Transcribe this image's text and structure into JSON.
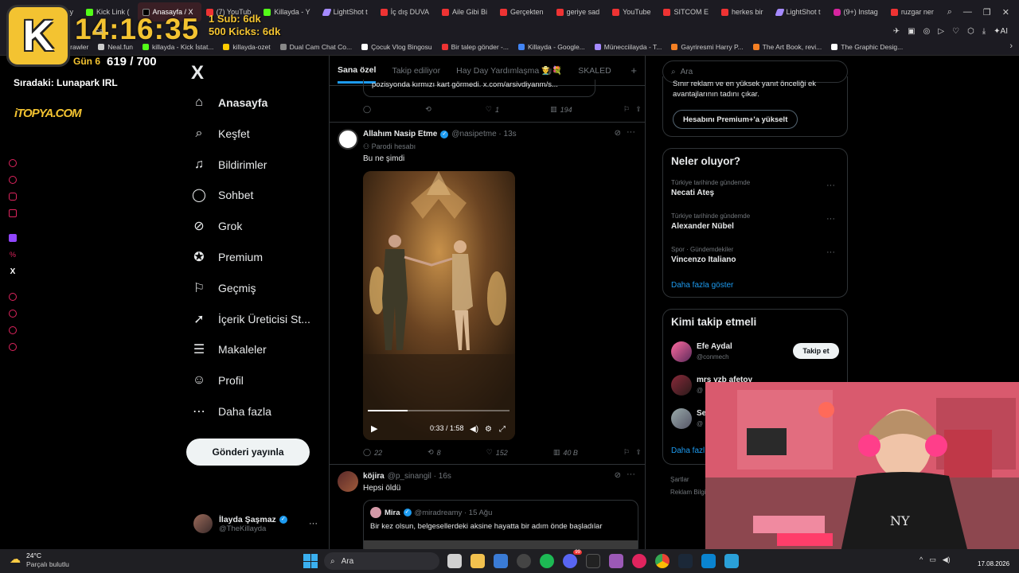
{
  "browser": {
    "tabs": [
      {
        "label": "away",
        "fav": "yt"
      },
      {
        "label": "Kick Link (",
        "fav": "k"
      },
      {
        "label": "Anasayfa / X",
        "fav": "x",
        "active": true
      },
      {
        "label": "(7) YouTub",
        "fav": "yt"
      },
      {
        "label": "Killayda - Y",
        "fav": "k"
      },
      {
        "label": "LightShot t",
        "fav": "ls"
      },
      {
        "label": "İç dış DUVA",
        "fav": "yt"
      },
      {
        "label": "Aile Gibi Bi",
        "fav": "yt"
      },
      {
        "label": "Gerçekten",
        "fav": "yt"
      },
      {
        "label": "geriye sad",
        "fav": "yt"
      },
      {
        "label": "YouTube",
        "fav": "yt"
      },
      {
        "label": "SITCOM E",
        "fav": "yt"
      },
      {
        "label": "herkes bir",
        "fav": "yt"
      },
      {
        "label": "LightShot t",
        "fav": "ls"
      },
      {
        "label": "(9+) Instag",
        "fav": "ig"
      },
      {
        "label": "ruzgar ner",
        "fav": "yt"
      }
    ],
    "new_tab": "+",
    "url_fragment": "ca",
    "bookmarks": [
      "Crawler",
      "Neal.fun",
      "killayda - Kick İstat...",
      "killayda-ozet",
      "Dual Cam Chat Co...",
      "Çocuk Vlog Bingosu",
      "Bir talep gönder -...",
      "Killayda - Google...",
      "Münecciilayda - T...",
      "Gayriresmi Harry P...",
      "The Art Book, revi...",
      "The Graphic Desig..."
    ]
  },
  "overlay": {
    "logo_letter": "K",
    "clock": "14:16:35",
    "sub_line": "1 Sub: 6dk",
    "kick_line": "500 Kicks: 6dk",
    "day_label": "Gün 6",
    "progress": "619 / 700",
    "next_label": "Sıradaki: Lunapark IRL",
    "sponsor": "iTOPYA.COM"
  },
  "x": {
    "logo": "X",
    "nav": [
      {
        "label": "Anasayfa",
        "icon": "home-icon",
        "glyph": "⌂"
      },
      {
        "label": "Keşfet",
        "icon": "search-icon",
        "glyph": "⌕"
      },
      {
        "label": "Bildirimler",
        "icon": "bell-icon",
        "glyph": "♫"
      },
      {
        "label": "Sohbet",
        "icon": "chat-icon",
        "glyph": "◯"
      },
      {
        "label": "Grok",
        "icon": "grok-icon",
        "glyph": "⊘"
      },
      {
        "label": "Premium",
        "icon": "premium-icon",
        "glyph": "✪"
      },
      {
        "label": "Geçmiş",
        "icon": "bookmark-icon",
        "glyph": "⚐"
      },
      {
        "label": "İçerik Üreticisi St...",
        "icon": "rocket-icon",
        "glyph": "➚"
      },
      {
        "label": "Makaleler",
        "icon": "article-icon",
        "glyph": "☰"
      },
      {
        "label": "Profil",
        "icon": "profile-icon",
        "glyph": "☺"
      },
      {
        "label": "Daha fazla",
        "icon": "more-icon",
        "glyph": "⋯"
      }
    ],
    "post_button": "Gönderi yayınla",
    "profile": {
      "name": "İlayda Şaşmaz",
      "handle": "@TheKillayda",
      "more": "···"
    }
  },
  "feed": {
    "tabs": [
      "Sana özel",
      "Takip ediliyor",
      "Hay Day Yardımlaşma 👨‍🌾💐",
      "SKALED"
    ],
    "add_tab": "+",
    "prev_tweet": {
      "text": "pozisyonda kırmızı kart görmedi. x.com/arsivdiyanm/s...",
      "replies": "",
      "retweets": "",
      "likes": "1",
      "views": "194"
    },
    "tweet1": {
      "name": "Allahım Nasip Etme",
      "handle": "@nasipetme · 13s",
      "badge": "Parodi hesabı",
      "text": "Bu ne şimdi",
      "video_time": "0:33 / 1:58",
      "video_progress": 0.28,
      "replies": "22",
      "retweets": "8",
      "likes": "152",
      "views": "40 B"
    },
    "tweet2": {
      "name": "köjira",
      "handle": "@p_sinangil · 16s",
      "text": "Hepsi öldü",
      "quote": {
        "name": "Mira",
        "handle": "@miradreamy · 15 Ağu",
        "text": "Bir kez olsun, belgesellerdeki aksine hayatta bir adım önde başladılar"
      }
    }
  },
  "right": {
    "search_placeholder": "Ara",
    "premium_text": "Sınır reklam ve en yüksek yanıt önceliği ek avantajlarının tadını çıkar.",
    "premium_button": "Hesabını Premium+'a yükselt",
    "trends_title": "Neler oluyor?",
    "trends": [
      {
        "context": "Türkiye tarihinde gündemde",
        "name": "Necati Ateş"
      },
      {
        "context": "Türkiye tarihinde gündemde",
        "name": "Alexander Nübel"
      },
      {
        "context": "Spor · Gündemdekiler",
        "name": "Vincenzo Italiano"
      }
    ],
    "trends_more": "Daha fazla göster",
    "who_title": "Kimi takip etmeli",
    "who": [
      {
        "name": "Efe Aydal",
        "handle": "@conmech",
        "button": "Takip et"
      },
      {
        "name": "mrs yzb afetoy",
        "handle": "@",
        "button": ""
      },
      {
        "name": "Se",
        "handle": "@",
        "button": ""
      }
    ],
    "who_more": "Daha fazl",
    "footer1": "Şartlar",
    "footer2": "Reklam Bilgi"
  },
  "taskbar": {
    "weather_temp": "24°C",
    "weather_desc": "Parçalı bulutlu",
    "search": "Ara",
    "date": "17.08.2026",
    "badge_count": "99"
  }
}
